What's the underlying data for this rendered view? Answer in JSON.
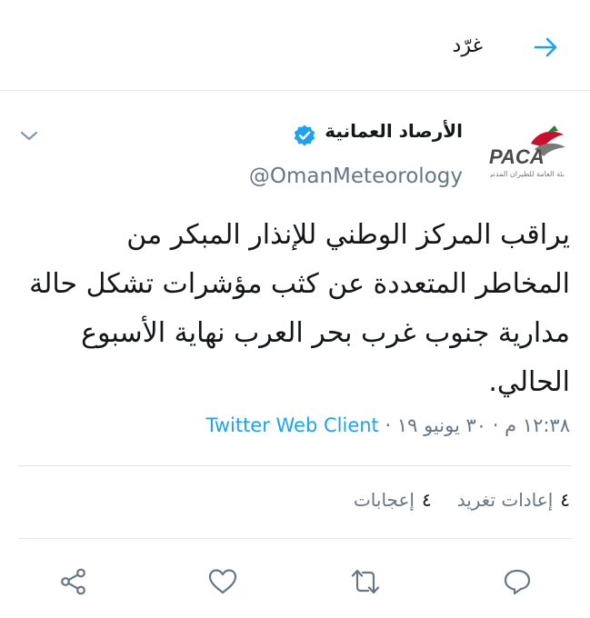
{
  "header": {
    "title": "غرّد",
    "back_icon": "arrow-right-icon"
  },
  "tweet": {
    "display_name": "الأرصاد العمانية",
    "handle": "@OmanMeteorology",
    "verified": true,
    "avatar": {
      "logo_text": "PACA",
      "logo_subtitle": "الهيئة العامة للطيران المدني"
    },
    "text": "يراقب المركز الوطني للإنذار المبكر من المخاطر المتعددة عن كثب مؤشرات تشكل حالة مدارية جنوب غرب بحر العرب نهاية الأسبوع الحالي.",
    "time": "١٢:٣٨ م",
    "date": "٣٠ يونيو ١٩",
    "separator": "·",
    "client": "Twitter Web Client"
  },
  "stats": {
    "retweets_count": "٤",
    "retweets_label": "إعادات تغريد",
    "likes_count": "٤",
    "likes_label": "إعجابات"
  },
  "actions": [
    "reply-icon",
    "retweet-icon",
    "like-icon",
    "share-icon"
  ],
  "colors": {
    "accent": "#1da1f2",
    "secondary_text": "#657786",
    "divider": "#e1e8ed"
  }
}
